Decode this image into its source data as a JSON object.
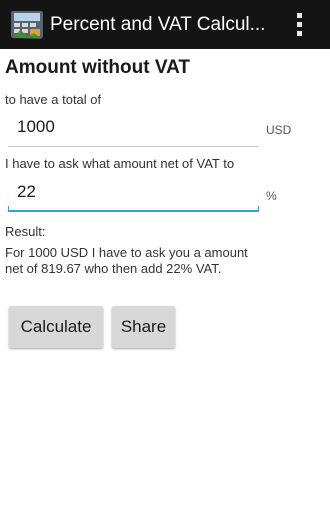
{
  "actionbar": {
    "title": "Percent and VAT Calcul...",
    "app_icon": "calculator-icon",
    "menu_icon": "overflow-menu-icon",
    "background": "#141414"
  },
  "form": {
    "heading": "Amount without VAT",
    "total_label": "to have a total of",
    "total_value": "1000",
    "total_unit": "USD",
    "vat_label": "I have to ask what amount net of VAT to",
    "vat_value": "22",
    "vat_unit": "%",
    "focus_color": "#33a1d6"
  },
  "result": {
    "label": "Result:",
    "text": "For 1000 USD I have to ask you a amount net of 819.67 who then add 22% VAT."
  },
  "buttons": {
    "calculate": "Calculate",
    "share": "Share"
  }
}
